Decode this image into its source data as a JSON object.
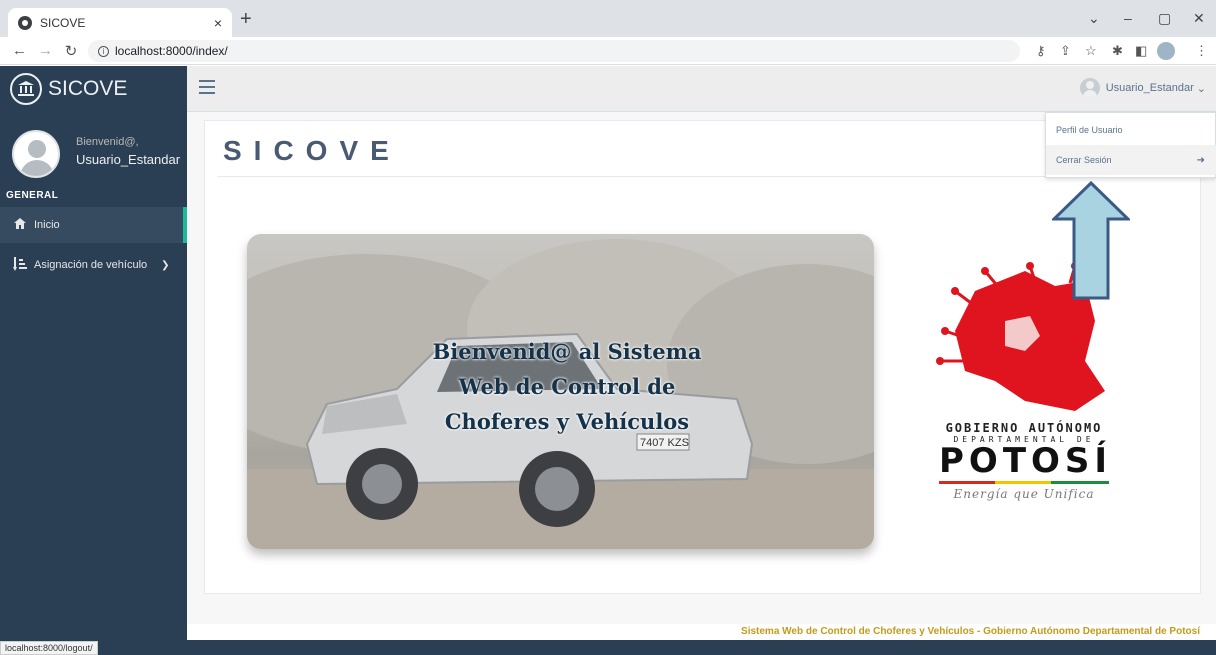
{
  "browser": {
    "tab_title": "SICOVE",
    "tab_close": "×",
    "new_tab": "+",
    "url": "localhost:8000/index/",
    "status_url": "localhost:8000/logout/",
    "window_controls": [
      "⌄",
      "–",
      "▢",
      "✕"
    ]
  },
  "sidebar": {
    "brand": "SICOVE",
    "welcome": "Bienvenid@,",
    "username": "Usuario_Estandar",
    "section_title": "GENERAL",
    "items": [
      {
        "label": "Inicio",
        "icon": "home-icon"
      },
      {
        "label": "Asignación de vehículo",
        "icon": "sort-icon"
      }
    ]
  },
  "topnav": {
    "user_label": "Usuario_Estandar",
    "chevron": "⌄"
  },
  "dropdown": {
    "items": [
      {
        "label": "Perfil de Usuario"
      },
      {
        "label": "Cerrar Sesión",
        "icon": "sign-out-icon"
      }
    ]
  },
  "main": {
    "panel_title": "SICOVE",
    "hero_lines": [
      "Bienvenid@ al Sistema",
      "Web de Control de",
      "Choferes y Vehículos"
    ],
    "plate": "7407 KZS",
    "logo": {
      "line1": "GOBIERNO AUTÓNOMO",
      "line2": "DEPARTAMENTAL DE",
      "line3": "POTOSÍ",
      "line4": "Energía que Unifica"
    }
  },
  "footer": {
    "text": "Sistema Web de Control de Choferes y Vehículos - Gobierno Autónomo Departamental de Potosí"
  },
  "colors": {
    "sidebar_bg": "#2a3f54",
    "active_accent": "#1abb9c",
    "footer_text": "#c49a1a",
    "arrow_fill": "#a9d3e0",
    "arrow_stroke": "#3a5a85"
  }
}
